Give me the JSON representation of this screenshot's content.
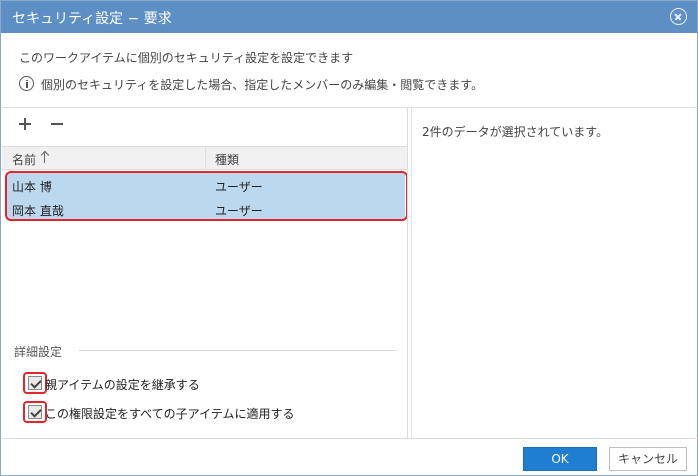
{
  "dialog": {
    "title": "セキュリティ設定 − 要求",
    "description": "このワークアイテムに個別のセキュリティ設定を設定できます",
    "info_text": "個別のセキュリティを設定した場合、指定したメンバーのみ編集・閲覧できます。"
  },
  "toolbar": {
    "add_icon": "plus-icon",
    "remove_icon": "minus-icon"
  },
  "grid": {
    "columns": [
      "名前",
      "種類"
    ],
    "sort_icon": "sort-ascending-icon",
    "rows": [
      {
        "name": "山本 博",
        "type": "ユーザー"
      },
      {
        "name": "岡本 直哉",
        "type": "ユーザー"
      }
    ]
  },
  "details": {
    "section_title": "詳細設定",
    "options": [
      {
        "label": "親アイテムの設定を継承する",
        "checked": true
      },
      {
        "label": "この権限設定をすべての子アイテムに適用する",
        "checked": true
      }
    ]
  },
  "right_panel": {
    "selection_text": "2件のデータが選択されています。"
  },
  "footer": {
    "ok_label": "OK",
    "cancel_label": "キャンセル"
  },
  "colors": {
    "titlebar": "#5e8fc4",
    "selected_row": "#bcd8ee",
    "ok_button": "#1f7ed0",
    "highlight": "#e2262c"
  }
}
